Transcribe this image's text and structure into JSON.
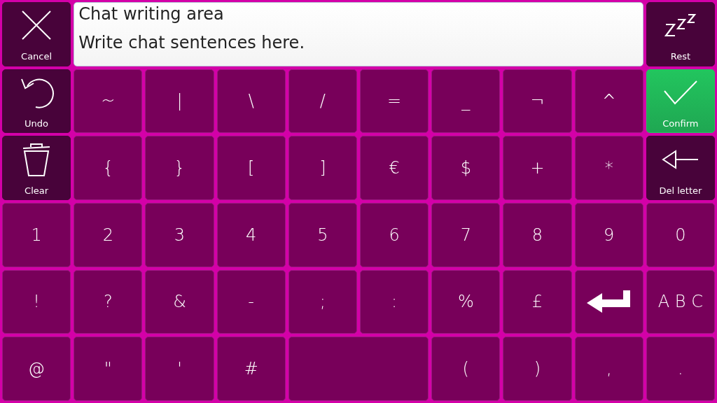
{
  "rows": [
    [
      {
        "kind": "cancel",
        "label": "Cancel"
      },
      {
        "kind": "writing-area",
        "title": "Chat writing area",
        "placeholder": "Write chat sentences here."
      },
      {
        "kind": "rest",
        "label": "Rest"
      }
    ],
    [
      {
        "kind": "undo",
        "label": "Undo"
      },
      {
        "kind": "char",
        "label": "~"
      },
      {
        "kind": "char",
        "label": "|"
      },
      {
        "kind": "char",
        "label": "\\"
      },
      {
        "kind": "char",
        "label": "/"
      },
      {
        "kind": "char",
        "label": "="
      },
      {
        "kind": "char",
        "label": "_"
      },
      {
        "kind": "char",
        "label": "¬"
      },
      {
        "kind": "char",
        "label": "^"
      },
      {
        "kind": "confirm",
        "label": "Confirm"
      }
    ],
    [
      {
        "kind": "clear",
        "label": "Clear"
      },
      {
        "kind": "char",
        "label": "{"
      },
      {
        "kind": "char",
        "label": "}"
      },
      {
        "kind": "char",
        "label": "["
      },
      {
        "kind": "char",
        "label": "]"
      },
      {
        "kind": "char",
        "label": "€"
      },
      {
        "kind": "char",
        "label": "$"
      },
      {
        "kind": "char",
        "label": "+"
      },
      {
        "kind": "char",
        "label": "*"
      },
      {
        "kind": "delete",
        "label": "Del letter"
      }
    ],
    [
      {
        "kind": "char",
        "label": "1"
      },
      {
        "kind": "char",
        "label": "2"
      },
      {
        "kind": "char",
        "label": "3"
      },
      {
        "kind": "char",
        "label": "4"
      },
      {
        "kind": "char",
        "label": "5"
      },
      {
        "kind": "char",
        "label": "6"
      },
      {
        "kind": "char",
        "label": "7"
      },
      {
        "kind": "char",
        "label": "8"
      },
      {
        "kind": "char",
        "label": "9"
      },
      {
        "kind": "char",
        "label": "0"
      }
    ],
    [
      {
        "kind": "char",
        "label": "!"
      },
      {
        "kind": "char",
        "label": "?"
      },
      {
        "kind": "char",
        "label": "&"
      },
      {
        "kind": "char",
        "label": "-"
      },
      {
        "kind": "char",
        "label": ";"
      },
      {
        "kind": "char",
        "label": ":"
      },
      {
        "kind": "char",
        "label": "%"
      },
      {
        "kind": "char",
        "label": "£"
      },
      {
        "kind": "enter"
      },
      {
        "kind": "char",
        "label": "A B C"
      }
    ],
    [
      {
        "kind": "char",
        "label": "@"
      },
      {
        "kind": "char",
        "label": "\""
      },
      {
        "kind": "char",
        "label": "'"
      },
      {
        "kind": "char",
        "label": "#"
      },
      {
        "kind": "space"
      },
      {
        "kind": "char",
        "label": "("
      },
      {
        "kind": "char",
        "label": ")"
      },
      {
        "kind": "char",
        "label": ","
      },
      {
        "kind": "char",
        "label": "."
      }
    ]
  ]
}
